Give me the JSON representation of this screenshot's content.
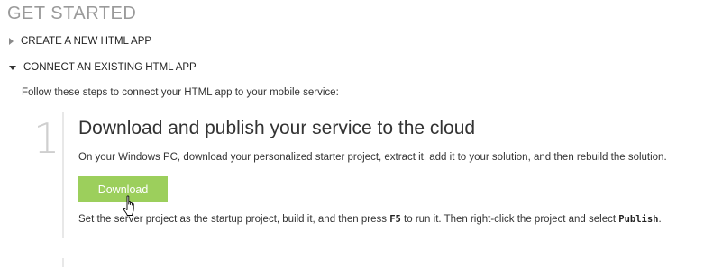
{
  "title": "GET STARTED",
  "sections": [
    {
      "label": "CREATE A NEW HTML APP",
      "expanded": false
    },
    {
      "label": "CONNECT AN EXISTING HTML APP",
      "expanded": true
    }
  ],
  "intro": "Follow these steps to connect your HTML app to your mobile service:",
  "step": {
    "number": "1",
    "heading": "Download and publish your service to the cloud",
    "description": "On your Windows PC, download your personalized starter project, extract it, add it to your solution, and then rebuild the solution.",
    "button_label": "Download",
    "note_part1": "Set the server project as the startup project, build it, and then press ",
    "note_key": "F5",
    "note_part2": " to run it. Then right-click the project and select ",
    "note_command": "Publish",
    "note_part3": "."
  },
  "colors": {
    "button_bg": "#9ccf5c",
    "title": "#9a9a9a",
    "step_number": "#cfcfcf"
  },
  "icons": {
    "create_toggle": "triangle-right-icon",
    "connect_toggle": "triangle-down-icon",
    "cursor": "hand-pointer-cursor-icon"
  }
}
